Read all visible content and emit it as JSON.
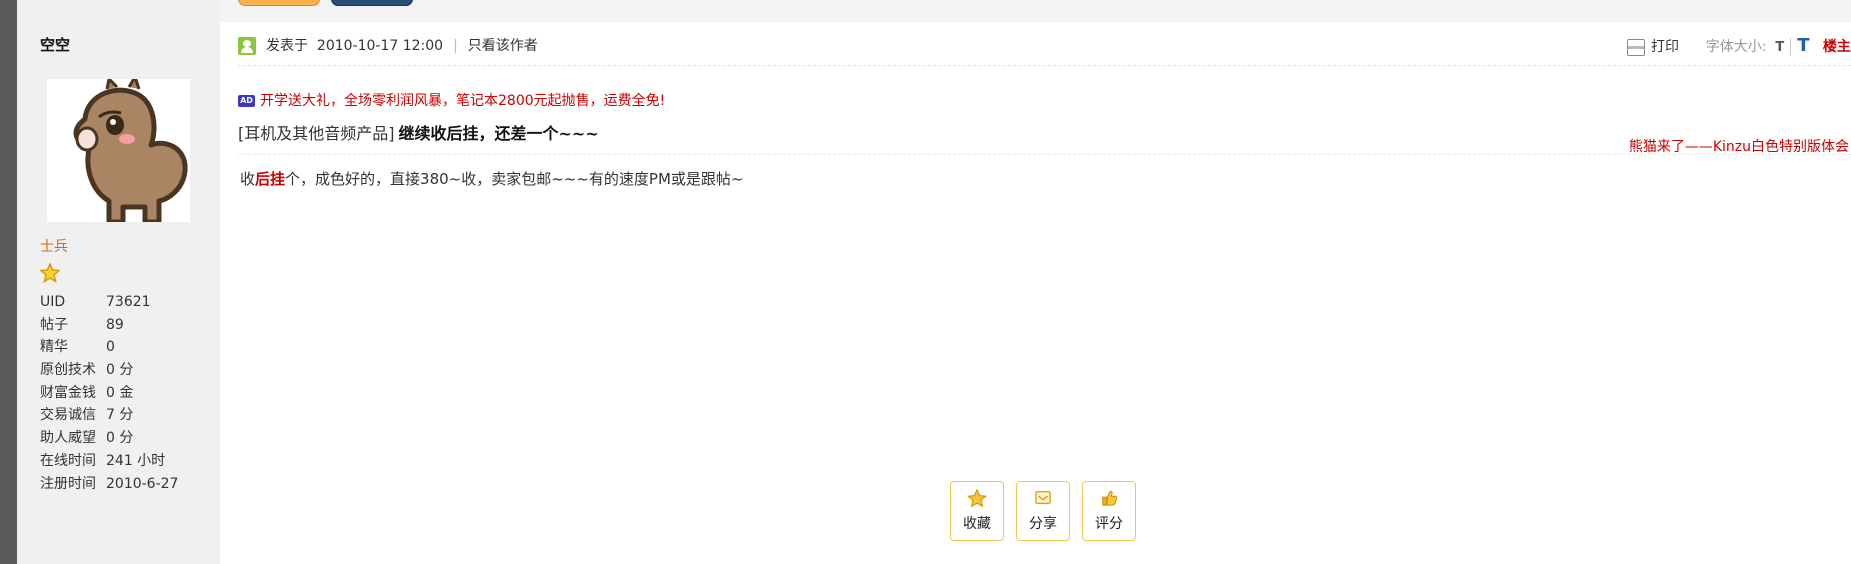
{
  "author": {
    "name": "空空",
    "rank": "士兵",
    "stats": [
      {
        "label": "UID",
        "value": "73621"
      },
      {
        "label": "帖子",
        "value": "89"
      },
      {
        "label": "精华",
        "value": "0"
      },
      {
        "label": "原创技术",
        "value": "0 分"
      },
      {
        "label": "财富金钱",
        "value": "0 金"
      },
      {
        "label": "交易诚信",
        "value": "7 分"
      },
      {
        "label": "助人威望",
        "value": "0 分"
      },
      {
        "label": "在线时间",
        "value": "241 小时"
      },
      {
        "label": "注册时间",
        "value": "2010-6-27"
      }
    ]
  },
  "post": {
    "posted_prefix": "发表于",
    "posted_time": "2010-10-17 12:00",
    "separator": "|",
    "only_author": "只看该作者",
    "print_label": "打印",
    "font_size_label": "字体大小:",
    "font_small": "T",
    "font_big": "T",
    "floor_label": "楼主",
    "ad_badge": "AD",
    "ad_text": "开学送大礼，全场零利润风暴，笔记本2800元起抛售，运费全免!",
    "category": "[耳机及其他音频产品]",
    "title": "继续收后挂，还差一个~~~",
    "side_ad": "熊猫来了——Kinzu白色特别版体会",
    "body_before": "收",
    "body_keyword": "后挂",
    "body_after": "个，成色好的，直接380~收，卖家包邮~~~有的速度PM或是跟帖~"
  },
  "actions": [
    {
      "label": "收藏",
      "icon": "star-icon"
    },
    {
      "label": "分享",
      "icon": "share-icon"
    },
    {
      "label": "评分",
      "icon": "thumbs-up-icon"
    }
  ],
  "colors": {
    "accent_red": "#cc0000",
    "rank_orange": "#d46a12",
    "button_border": "#f2c64b",
    "sidebar_bg": "#f0f0f0"
  }
}
